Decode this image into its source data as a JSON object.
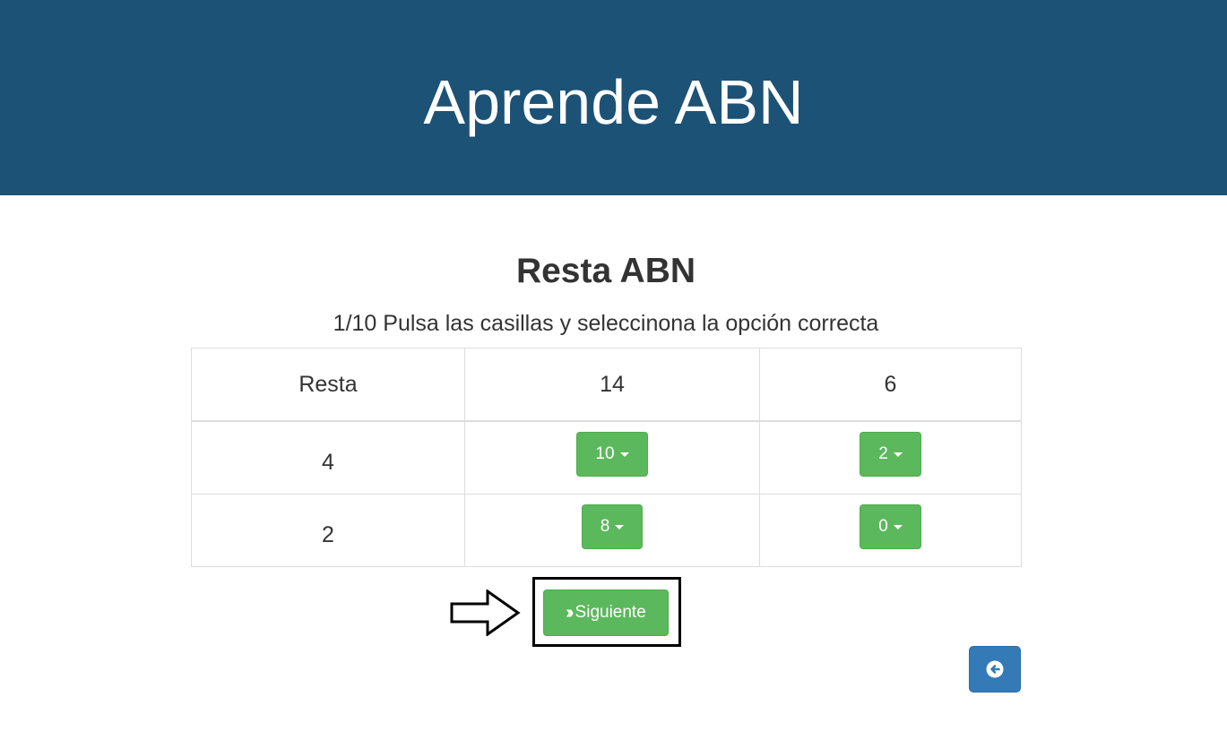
{
  "header": {
    "title": "Aprende ABN"
  },
  "main": {
    "title": "Resta ABN",
    "instructions": "1/10 Pulsa las casillas y seleccinona la opción correcta"
  },
  "table": {
    "head": [
      "Resta",
      "14",
      "6"
    ],
    "rows": [
      {
        "label": "4",
        "options": [
          "10",
          "2"
        ]
      },
      {
        "label": "2",
        "options": [
          "8",
          "0"
        ]
      }
    ]
  },
  "actions": {
    "next_label": "Siguiente",
    "next_icon": "double-chevron-right-icon",
    "back_icon": "circle-arrow-left-icon",
    "pointer_icon": "outline-arrow-right-icon"
  },
  "colors": {
    "header_bg": "#1c5276",
    "success": "#5cb85c",
    "primary": "#337ab7"
  }
}
